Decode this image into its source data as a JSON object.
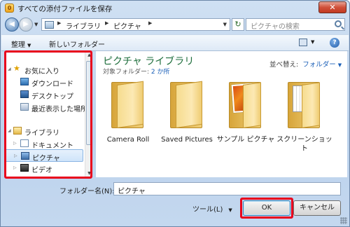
{
  "window": {
    "title": "すべての添付ファイルを保存",
    "close_label": "✕",
    "app_icon_glyph": "0"
  },
  "address_bar": {
    "segments": [
      "ライブラリ",
      "ピクチャ"
    ],
    "search_placeholder": "ピクチャの検索"
  },
  "toolbar": {
    "organize": "整理",
    "new_folder": "新しいフォルダー",
    "help": "?"
  },
  "sidebar": {
    "favorites_label": "お気に入り",
    "favorites": [
      "ダウンロード",
      "デスクトップ",
      "最近表示した場所"
    ],
    "libraries_label": "ライブラリ",
    "libraries": [
      "ドキュメント",
      "ピクチャ",
      "ビデオ"
    ],
    "selected": "ピクチャ"
  },
  "content": {
    "library_title": "ピクチャ ライブラリ",
    "target_prefix": "対象フォルダー:",
    "target_count": "2 か所",
    "arrange_label": "並べ替え:",
    "arrange_value": "フォルダー",
    "folders": [
      {
        "name": "Camera Roll",
        "type": "plain"
      },
      {
        "name": "Saved Pictures",
        "type": "plain"
      },
      {
        "name": "サンプル ピクチャ",
        "type": "photo"
      },
      {
        "name": "スクリーンショット",
        "type": "papers"
      }
    ]
  },
  "bottom": {
    "folder_name_label": "フォルダー名(N):",
    "folder_name_value": "ピクチャ",
    "tools_label": "ツール(L)",
    "ok": "OK",
    "cancel": "キャンセル"
  },
  "colors": {
    "highlight_frame": "#e8001c",
    "library_title": "#1e6e3c",
    "link": "#1a5fb8"
  }
}
